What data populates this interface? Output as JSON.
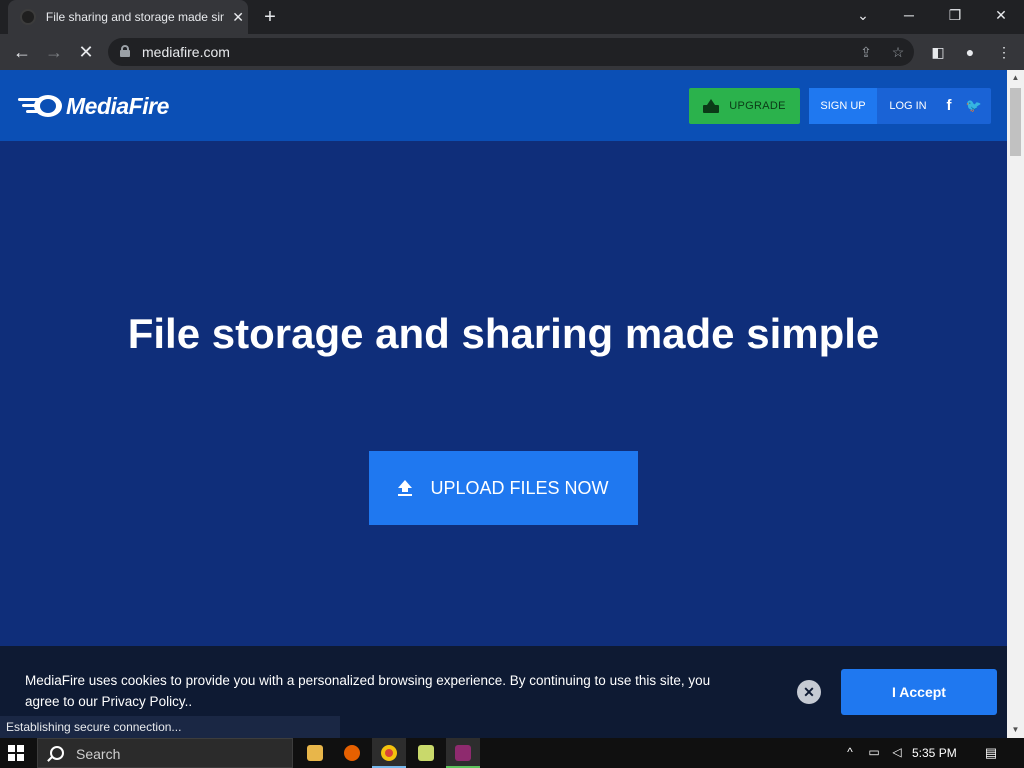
{
  "browser": {
    "tab_title": "File sharing and storage made simple",
    "tab_close": "✕",
    "new_tab": "+",
    "url": "mediafire.com",
    "status": "Establishing secure connection..."
  },
  "header": {
    "logo_text": "MediaFire",
    "upgrade_label": "UPGRADE",
    "signup_label": "SIGN UP",
    "login_label": "LOG IN",
    "facebook_glyph": "f",
    "twitter_glyph": "🐦"
  },
  "hero": {
    "title": "File storage and sharing made simple",
    "upload_label": "UPLOAD FILES NOW"
  },
  "cookie": {
    "text": "MediaFire uses cookies to provide you with a personalized browsing experience. By continuing to use this site, you agree to our Privacy Policy..",
    "close_glyph": "✕",
    "accept_label": "I Accept"
  },
  "taskbar": {
    "search_placeholder": "Search",
    "time": "5:35 PM"
  },
  "colors": {
    "header_blue": "#0b4fb5",
    "hero_blue": "#0f2e7a",
    "accent_blue": "#1f78f0",
    "upgrade_green": "#2bb24c"
  }
}
